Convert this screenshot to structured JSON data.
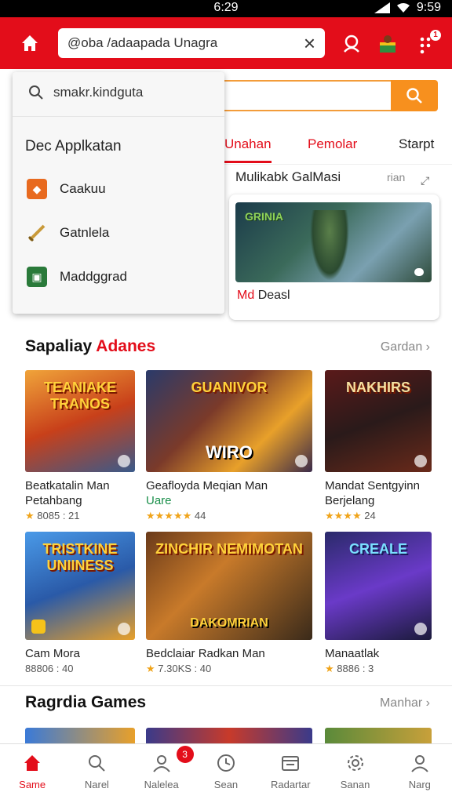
{
  "status_bar": {
    "time": "6:29",
    "right_time": "9:59"
  },
  "header": {
    "search_value": "@oba /adaapada Unagra",
    "badge": "1"
  },
  "background": {
    "tabs": [
      "Unahan",
      "Pemolar",
      "Starpt"
    ],
    "sub_heading": "Mulikabk GalMasi",
    "sub_right": "rian",
    "featured_title_red": "Md",
    "featured_title_rest": "Deasl",
    "featured_logo": "GRINIA"
  },
  "dropdown": {
    "search_text": "smakr.kindguta",
    "heading": "Dec  Applkatan",
    "items": [
      {
        "label": "Caakuu",
        "color": "#e86a1f",
        "icon": "app-icon"
      },
      {
        "label": "Gatnlela",
        "color": "#c99a3a",
        "icon": "sword-icon"
      },
      {
        "label": "Maddggrad",
        "color": "#2a7a3a",
        "icon": "game-icon"
      }
    ]
  },
  "section1": {
    "title_black": "Sapaliay",
    "title_red": "Adanes",
    "more": "Gardan"
  },
  "section1_games": [
    {
      "art_top": "TEANIAKE TRANOS",
      "art_bottom": "",
      "name_line1": "Beatkatalin Man",
      "name_line2": "Petahbang",
      "name_line2_green": false,
      "stars": "★",
      "rating": "8085 : 21"
    },
    {
      "art_top": "GUANIVOR",
      "art_bottom": "WIRO",
      "name_line1": "Geafloyda Meqian Man",
      "name_line2": "Uare",
      "name_line2_green": true,
      "stars": "★★★★★",
      "rating": "44"
    },
    {
      "art_top": "NAKHIRS",
      "art_bottom": "",
      "name_line1": "Mandat Sentgyinn",
      "name_line2": "Berjelang",
      "name_line2_green": false,
      "stars": "★★★★",
      "rating": "24"
    }
  ],
  "section2_games": [
    {
      "art_top": "TRISTKINE UNIINESS",
      "art_bottom": "",
      "name_line1": "Cam Mora",
      "name_line2": "",
      "stars": "",
      "rating": "88806 : 40"
    },
    {
      "art_top": "ZINCHIR  NEMIMOTAN",
      "art_bottom": "DAKOMRIAN",
      "name_line1": "Bedclaiar Radkan Man",
      "name_line2": "",
      "stars": "★",
      "rating": "7.30KS : 40"
    },
    {
      "art_top": "CREALE",
      "art_bottom": "",
      "name_line1": "Manaatlak",
      "name_line2": "",
      "stars": "★",
      "rating": "8886 : 3"
    }
  ],
  "section3": {
    "title": "Ragrdia Games",
    "more": "Manhar"
  },
  "bottom_nav": [
    {
      "label": "Same",
      "icon": "home-icon",
      "active": true
    },
    {
      "label": "Narel",
      "icon": "search-icon",
      "active": false
    },
    {
      "label": "Nalelea",
      "icon": "profile-icon",
      "active": false,
      "badge": "3"
    },
    {
      "label": "Sean",
      "icon": "clock-icon",
      "active": false
    },
    {
      "label": "Radartar",
      "icon": "calendar-icon",
      "active": false
    },
    {
      "label": "Sanan",
      "icon": "settings-icon",
      "active": false
    },
    {
      "label": "Narg",
      "icon": "user-icon",
      "active": false
    }
  ],
  "colors": {
    "accent": "#e30d1a",
    "orange": "#f7901e",
    "star": "#f0a41a"
  }
}
